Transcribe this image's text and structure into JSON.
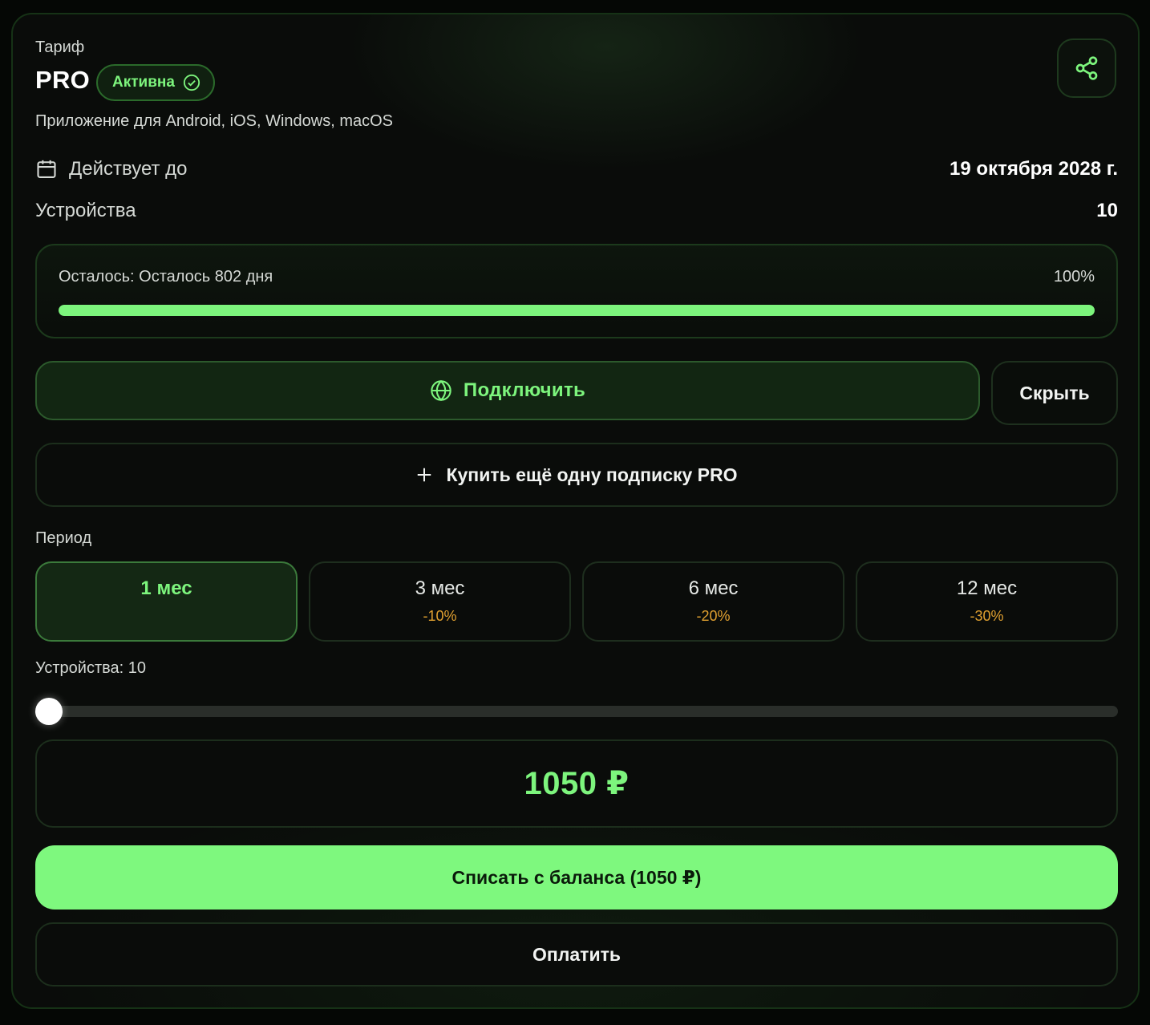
{
  "header": {
    "caption": "Тариф",
    "plan_name": "PRO",
    "status": "Активна",
    "platforms": "Приложение для Android, iOS, Windows, macOS"
  },
  "details": {
    "valid_label": "Действует до",
    "valid_value": "19 октября 2028 г.",
    "devices_label": "Устройства",
    "devices_value": "10"
  },
  "progress": {
    "text": "Осталось: Осталось 802 дня",
    "percent_label": "100%",
    "percent": 1.0
  },
  "actions": {
    "connect_label": "Подключить",
    "hide_label": "Скрыть",
    "buy_more_label": "Купить ещё одну подписку PRO"
  },
  "period": {
    "title": "Период",
    "options": [
      {
        "label": "1 мес",
        "discount": "",
        "selected": true
      },
      {
        "label": "3 мес",
        "discount": "-10%",
        "selected": false
      },
      {
        "label": "6 мес",
        "discount": "-20%",
        "selected": false
      },
      {
        "label": "12 мес",
        "discount": "-30%",
        "selected": false
      }
    ]
  },
  "devices_slider": {
    "label": "Устройства: 10",
    "value": 10
  },
  "price": {
    "total": "1050 ₽"
  },
  "payment": {
    "balance_label": "Списать с баланса (1050 ₽)",
    "pay_label": "Оплатить"
  },
  "colors": {
    "accent": "#7ef87e",
    "background": "#0a0c0a",
    "discount": "#e0a030"
  },
  "icons": {
    "status": "check-circle-icon",
    "share": "share-icon",
    "calendar": "calendar-icon",
    "connect": "globe-icon",
    "buy_more": "plus-icon"
  }
}
